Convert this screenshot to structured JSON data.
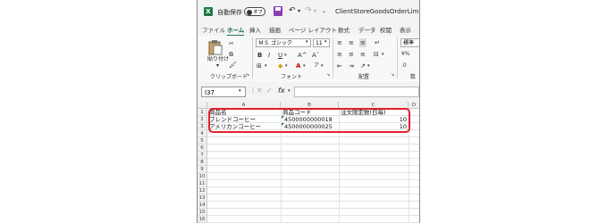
{
  "titlebar": {
    "autosave_label": "自動保存",
    "autosave_state": "オフ",
    "file_name": "ClientStoreGoodsOrderLimitExp"
  },
  "tabs": [
    "ファイル",
    "ホーム",
    "挿入",
    "描画",
    "ページ レイアウト",
    "数式",
    "データ",
    "校閲",
    "表示"
  ],
  "active_tab": "ホーム",
  "ribbon": {
    "paste_label": "貼り付け",
    "clipboard_group": "クリップボード",
    "font_group": "フォント",
    "alignment_group": "配置",
    "number_group": "数",
    "font_name": "ＭＳ ゴシック",
    "font_size": "11",
    "number_format": "標準",
    "bold": "B",
    "italic": "I",
    "underline": "U",
    "font_grow": "A^",
    "font_shrink": "Aˇ"
  },
  "formula_bar": {
    "name_box": "I37",
    "fx_label": "fx",
    "formula": ""
  },
  "sheet": {
    "columns": [
      "A",
      "B",
      "C",
      "D"
    ],
    "rows": [
      "1",
      "2",
      "3",
      "4",
      "5",
      "6",
      "7",
      "8",
      "9",
      "10",
      "11",
      "12",
      "13",
      "14",
      "15",
      "16"
    ],
    "data": [
      [
        "商品名",
        "商品コード",
        "注文限定数(日毎)"
      ],
      [
        "ブレンドコーヒー",
        "4500000000018",
        "10"
      ],
      [
        "アメリカンコーヒー",
        "4500000000025",
        "10"
      ]
    ]
  },
  "colors": {
    "excel_green": "#1f7a45",
    "highlight_red": "#e0202e"
  }
}
